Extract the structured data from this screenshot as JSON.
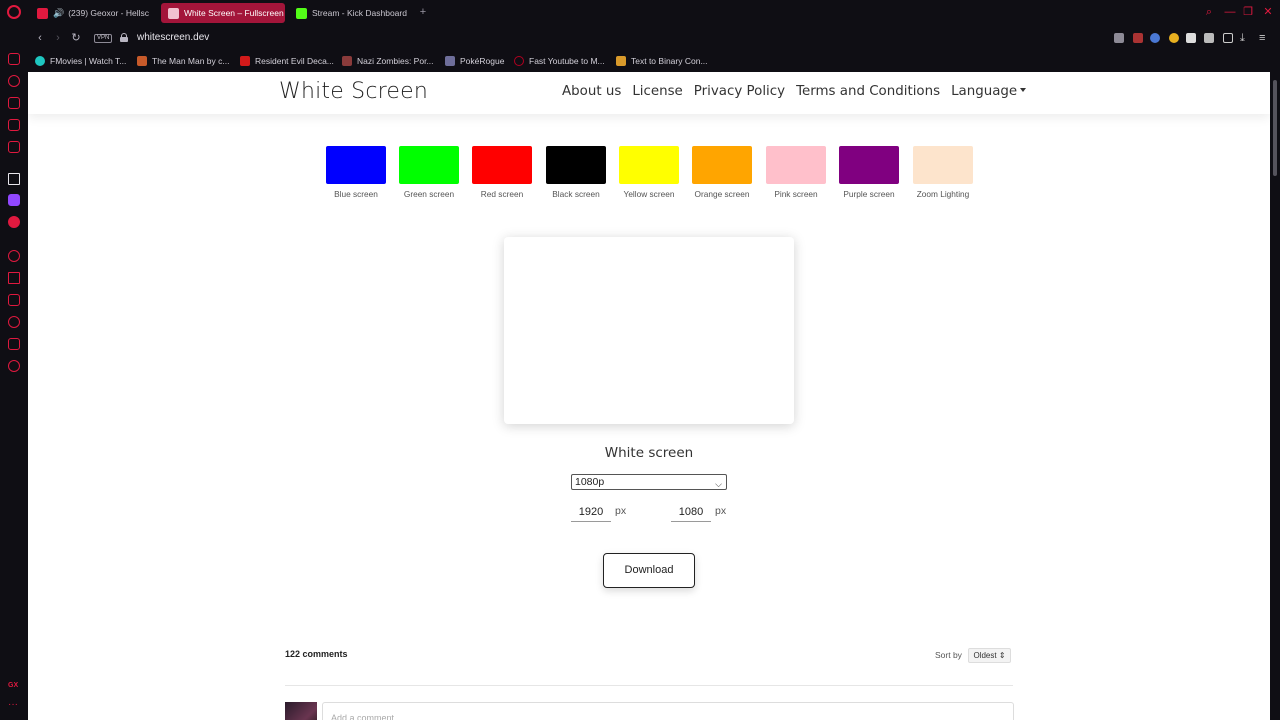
{
  "browser": {
    "tabs": [
      {
        "label": "(239) Geoxor - Hellsc",
        "color": "#e0193f"
      },
      {
        "label": "White Screen – Fullscreen",
        "color": "#ffffff",
        "active": true
      },
      {
        "label": "Stream - Kick Dashboard",
        "color": "#53fc18"
      }
    ],
    "url": "whitescreen.dev",
    "vpn": "VPN",
    "bookmarks": [
      {
        "label": "FMovies | Watch T...",
        "color": "#1ec7c1"
      },
      {
        "label": "The Man Man by c...",
        "color": "#c75a2a"
      },
      {
        "label": "Resident Evil Deca...",
        "color": "#d21a1a"
      },
      {
        "label": "Nazi Zombies: Por...",
        "color": "#8a3b3b"
      },
      {
        "label": "PokéRogue",
        "color": "#6e6e9a"
      },
      {
        "label": "Fast Youtube to M...",
        "color": "#b00020"
      },
      {
        "label": "Text to Binary Con...",
        "color": "#d99a2b"
      }
    ]
  },
  "site": {
    "brand": "White Screen",
    "nav": [
      "About us",
      "License",
      "Privacy Policy",
      "Terms and Conditions",
      "Language"
    ],
    "swatches": [
      {
        "label": "Blue screen",
        "color": "#0000ff"
      },
      {
        "label": "Green screen",
        "color": "#00ff00"
      },
      {
        "label": "Red screen",
        "color": "#ff0000"
      },
      {
        "label": "Black screen",
        "color": "#000000"
      },
      {
        "label": "Yellow screen",
        "color": "#ffff00"
      },
      {
        "label": "Orange screen",
        "color": "#ffa500"
      },
      {
        "label": "Pink screen",
        "color": "#ffc0cb"
      },
      {
        "label": "Purple screen",
        "color": "#800080"
      },
      {
        "label": "Zoom Lighting",
        "color": "#fde4cc"
      }
    ],
    "preview_title": "White screen",
    "resolution": "1080p",
    "width": "1920",
    "height": "1080",
    "unit": "px",
    "download": "Download",
    "comments": {
      "count": "122 comments",
      "sort_label": "Sort by",
      "sort_value": "Oldest ⇕",
      "placeholder": "Add a comment..."
    }
  }
}
